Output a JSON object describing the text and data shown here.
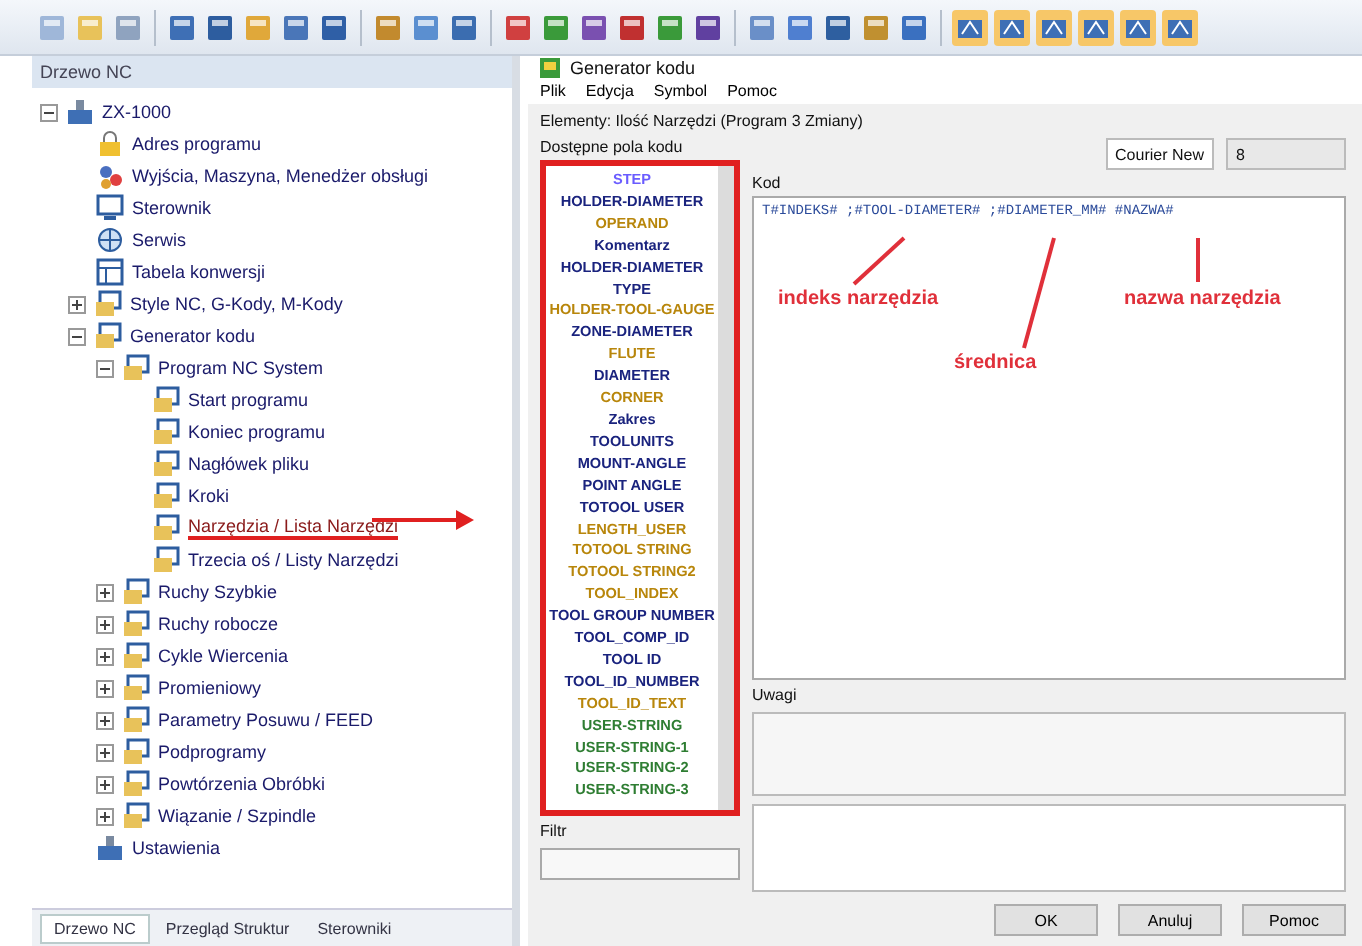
{
  "left_panel": {
    "title": "Drzewo NC",
    "tree": [
      {
        "label": "ZX-1000",
        "kind": "machine",
        "expanded": true,
        "selected": false,
        "children": [
          {
            "label": "Adres programu",
            "kind": "lock",
            "selected": false
          },
          {
            "label": "Wyjścia, Maszyna, Menedżer obsługi",
            "kind": "people",
            "selected": false
          },
          {
            "label": "Sterownik",
            "kind": "monitor",
            "selected": false
          },
          {
            "label": "Serwis",
            "kind": "globe",
            "selected": false
          },
          {
            "label": "Tabela konwersji",
            "kind": "table",
            "selected": false
          },
          {
            "label": "Style NC, G-Kody, M-Kody",
            "kind": "folder",
            "expanded": false,
            "selected": false
          },
          {
            "label": "Generator kodu",
            "kind": "folder",
            "expanded": true,
            "selected": false,
            "children": [
              {
                "label": "Program NC System",
                "kind": "folder",
                "expanded": true,
                "selected": false,
                "children": [
                  {
                    "label": "Start programu",
                    "kind": "folder",
                    "selected": false
                  },
                  {
                    "label": "Koniec programu",
                    "kind": "folder",
                    "selected": false
                  },
                  {
                    "label": "Nagłówek pliku",
                    "kind": "folder",
                    "selected": false
                  },
                  {
                    "label": "Kroki",
                    "kind": "folder",
                    "selected": false
                  },
                  {
                    "label": "Narzędzia / Lista Narzędzi",
                    "kind": "folder",
                    "selected": true
                  },
                  {
                    "label": "Trzecia oś / Listy Narzędzi",
                    "kind": "folder",
                    "selected": false
                  }
                ]
              },
              {
                "label": "Ruchy Szybkie",
                "kind": "folder",
                "expanded": false,
                "selected": false
              },
              {
                "label": "Ruchy robocze",
                "kind": "folder",
                "expanded": false,
                "selected": false
              },
              {
                "label": "Cykle Wiercenia",
                "kind": "folder",
                "expanded": false,
                "selected": false
              },
              {
                "label": "Promieniowy",
                "kind": "folder",
                "expanded": false,
                "selected": false
              },
              {
                "label": "Parametry Posuwu / FEED",
                "kind": "folder",
                "expanded": false,
                "selected": false
              },
              {
                "label": "Podprogramy",
                "kind": "folder",
                "expanded": false,
                "selected": false
              },
              {
                "label": "Powtórzenia Obróbki",
                "kind": "folder",
                "expanded": false,
                "selected": false
              },
              {
                "label": "Wiązanie / Szpindle",
                "kind": "folder",
                "expanded": false,
                "selected": false
              }
            ]
          },
          {
            "label": "Ustawienia",
            "kind": "machine",
            "selected": false
          }
        ]
      }
    ],
    "tabs": [
      {
        "label": "Drzewo NC",
        "selected": true
      },
      {
        "label": "Przegląd Struktur",
        "selected": false
      },
      {
        "label": "Sterowniki",
        "selected": false
      }
    ]
  },
  "dialog": {
    "title": "Generator kodu",
    "menu": [
      "Plik",
      "Edycja",
      "Symbol",
      "Pomoc"
    ],
    "group_label": "Elementy: Ilość Narzędzi (Program 3 Zmiany)",
    "fields_label": "Dostępne pola kodu",
    "fields": [
      {
        "label": "STEP",
        "color": "#6a5cff"
      },
      {
        "label": "HOLDER-DIAMETER",
        "color": "#1a237e"
      },
      {
        "label": "OPERAND",
        "color": "#b8860b"
      },
      {
        "label": "Komentarz",
        "color": "#1a237e"
      },
      {
        "label": "HOLDER-DIAMETER",
        "color": "#1a237e"
      },
      {
        "label": "TYPE",
        "color": "#1a237e"
      },
      {
        "label": "HOLDER-TOOL-GAUGE",
        "color": "#b8860b"
      },
      {
        "label": "ZONE-DIAMETER",
        "color": "#1a237e"
      },
      {
        "label": "FLUTE",
        "color": "#b8860b"
      },
      {
        "label": "DIAMETER",
        "color": "#1a237e"
      },
      {
        "label": "CORNER",
        "color": "#b8860b"
      },
      {
        "label": "Zakres",
        "color": "#1a237e"
      },
      {
        "label": "TOOLUNITS",
        "color": "#1a237e"
      },
      {
        "label": "MOUNT-ANGLE",
        "color": "#1a237e"
      },
      {
        "label": "POINT ANGLE",
        "color": "#1a237e"
      },
      {
        "label": "TOTOOL USER",
        "color": "#1a237e"
      },
      {
        "label": "LENGTH_USER",
        "color": "#b8860b"
      },
      {
        "label": "TOTOOL STRING",
        "color": "#b8860b"
      },
      {
        "label": "TOTOOL STRING2",
        "color": "#b8860b"
      },
      {
        "label": "TOOL_INDEX",
        "color": "#b8860b"
      },
      {
        "label": "TOOL GROUP NUMBER",
        "color": "#1a237e"
      },
      {
        "label": "TOOL_COMP_ID",
        "color": "#1a237e"
      },
      {
        "label": "TOOL ID",
        "color": "#1a237e"
      },
      {
        "label": "TOOL_ID_NUMBER",
        "color": "#1a237e"
      },
      {
        "label": "TOOL_ID_TEXT",
        "color": "#b8860b"
      },
      {
        "label": "USER-STRING",
        "color": "#2e7d32"
      },
      {
        "label": "USER-STRING-1",
        "color": "#2e7d32"
      },
      {
        "label": "USER-STRING-2",
        "color": "#2e7d32"
      },
      {
        "label": "USER-STRING-3",
        "color": "#2e7d32"
      }
    ],
    "filter_label": "Filtr",
    "font": "Courier New",
    "font_size": "8",
    "code_label": "Kod",
    "code": "T#INDEKS#  ;#TOOL-DIAMETER#  ;#DIAMETER_MM#  #NAZWA#",
    "annotations": [
      "indeks narzędzia",
      "średnica",
      "nazwa narzędzia"
    ],
    "notes_label": "Uwagi",
    "buttons": [
      "OK",
      "Anuluj",
      "Pomoc"
    ]
  }
}
